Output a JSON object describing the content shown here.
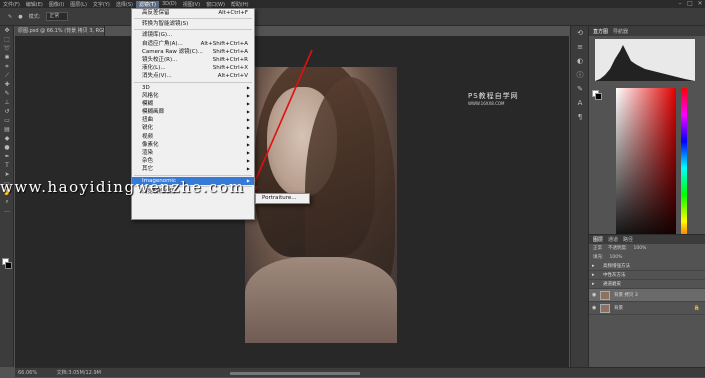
{
  "menubar": {
    "items": [
      "文件(F)",
      "编辑(E)",
      "图像(I)",
      "图层(L)",
      "文字(Y)",
      "选择(S)",
      "滤镜(T)",
      "3D(D)",
      "视图(V)",
      "窗口(W)",
      "帮助(H)"
    ],
    "active_index": 6
  },
  "optbar": {
    "mode_label": "模式:",
    "mode_value": "正常"
  },
  "document": {
    "tab_title": "原图.psd @ 66.1% (背景 拷贝 3, RGB/8*) *"
  },
  "filter_menu": {
    "last_filter": "高反差保留",
    "last_filter_shortcut": "Alt+Ctrl+F",
    "smart_filter": "转换为智能滤镜(S)",
    "gallery": "滤镜库(G)...",
    "adaptive_wide": "自适应广角(A)...",
    "adaptive_wide_shortcut": "Alt+Shift+Ctrl+A",
    "camera_raw": "Camera Raw 滤镜(C)...",
    "camera_raw_shortcut": "Shift+Ctrl+A",
    "lens_correction": "镜头校正(R)...",
    "lens_correction_shortcut": "Shift+Ctrl+R",
    "liquify": "液化(L)...",
    "liquify_shortcut": "Shift+Ctrl+X",
    "vanishing_point": "消失点(V)...",
    "vanishing_point_shortcut": "Alt+Ctrl+V",
    "groups": [
      "3D",
      "风格化",
      "模糊",
      "模糊画廊",
      "扭曲",
      "锐化",
      "视频",
      "像素化",
      "渲染",
      "杂色",
      "其它"
    ],
    "imagenomic": "Imagenomic",
    "browse_online": "浏览联机滤镜..."
  },
  "submenu": {
    "item": "Portraiture..."
  },
  "watermarks": {
    "site_url": "www.haoyidingwenzhe.com",
    "brand": "PS教程自学网",
    "brand_sub": "WWW.16XX8.COM"
  },
  "panels": {
    "histogram_tabs": [
      "直方图",
      "导航器"
    ],
    "layers_tabs": [
      "图层",
      "通道",
      "路径"
    ],
    "blend_mode": "正常",
    "opacity_label": "不透明度:",
    "opacity_value": "100%",
    "fill_label": "填充:",
    "fill_value": "100%",
    "layers": [
      "高频增强方法",
      "中性灰方法",
      "通道磨皮",
      "背景 拷贝 3",
      "背景"
    ]
  },
  "status": {
    "zoom": "66.06%",
    "doc_info": "文档:3.05M/12.9M"
  },
  "colors": {
    "menu_highlight": "#3779d6",
    "arrow": "#e01010"
  }
}
